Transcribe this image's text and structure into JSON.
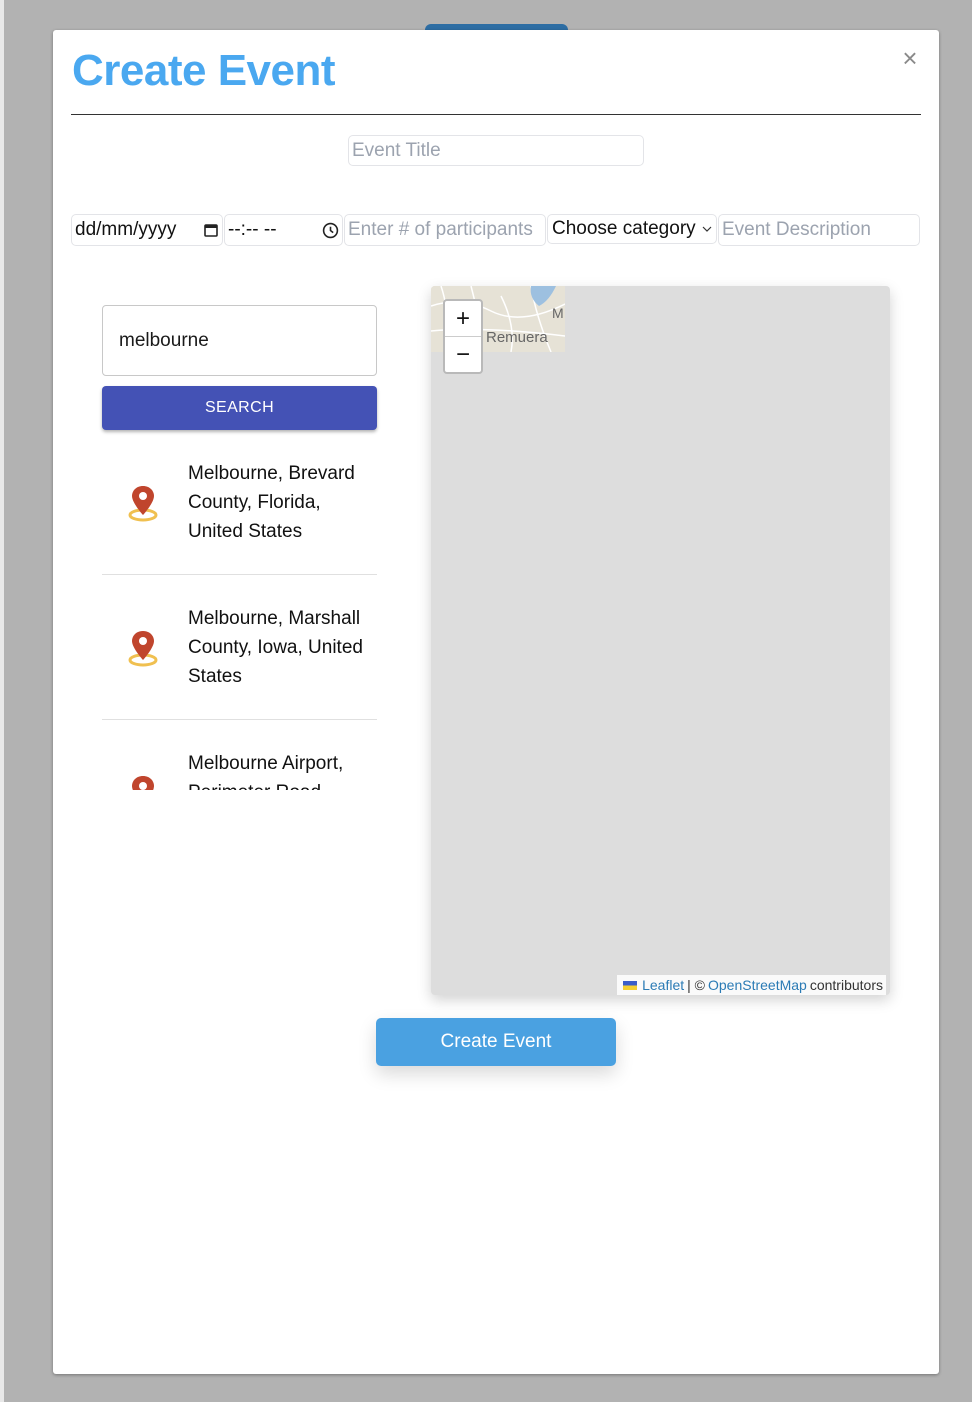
{
  "modal": {
    "title": "Create Event",
    "close_icon": "×"
  },
  "form": {
    "event_title_placeholder": "Event Title",
    "date_placeholder": "dd/mm/yyyy",
    "time_placeholder": "--:-- --",
    "participants_placeholder": "Enter # of participants",
    "category_selected": "Choose category",
    "description_placeholder": "Event Description"
  },
  "location_search": {
    "query": "melbourne",
    "search_label": "SEARCH",
    "results": [
      {
        "label": "Melbourne, Brevard County, Florida, United States"
      },
      {
        "label": "Melbourne, Marshall County, Iowa, United States"
      },
      {
        "label": "Melbourne Airport, Perimeter Road, Melbourne Airport"
      }
    ]
  },
  "map": {
    "place_label": "Remuera",
    "place_label_partial": "M",
    "zoom_in": "+",
    "zoom_out": "−",
    "attribution": {
      "leaflet": "Leaflet",
      "separator": "| ©",
      "osm": "OpenStreetMap",
      "suffix": "contributors"
    }
  },
  "actions": {
    "create_label": "Create Event"
  },
  "colors": {
    "title": "#4aa8f0",
    "search_button": "#4452b5",
    "create_button": "#4aa1e1",
    "pin": "#c0452d",
    "pin_ring": "#f0c050"
  }
}
